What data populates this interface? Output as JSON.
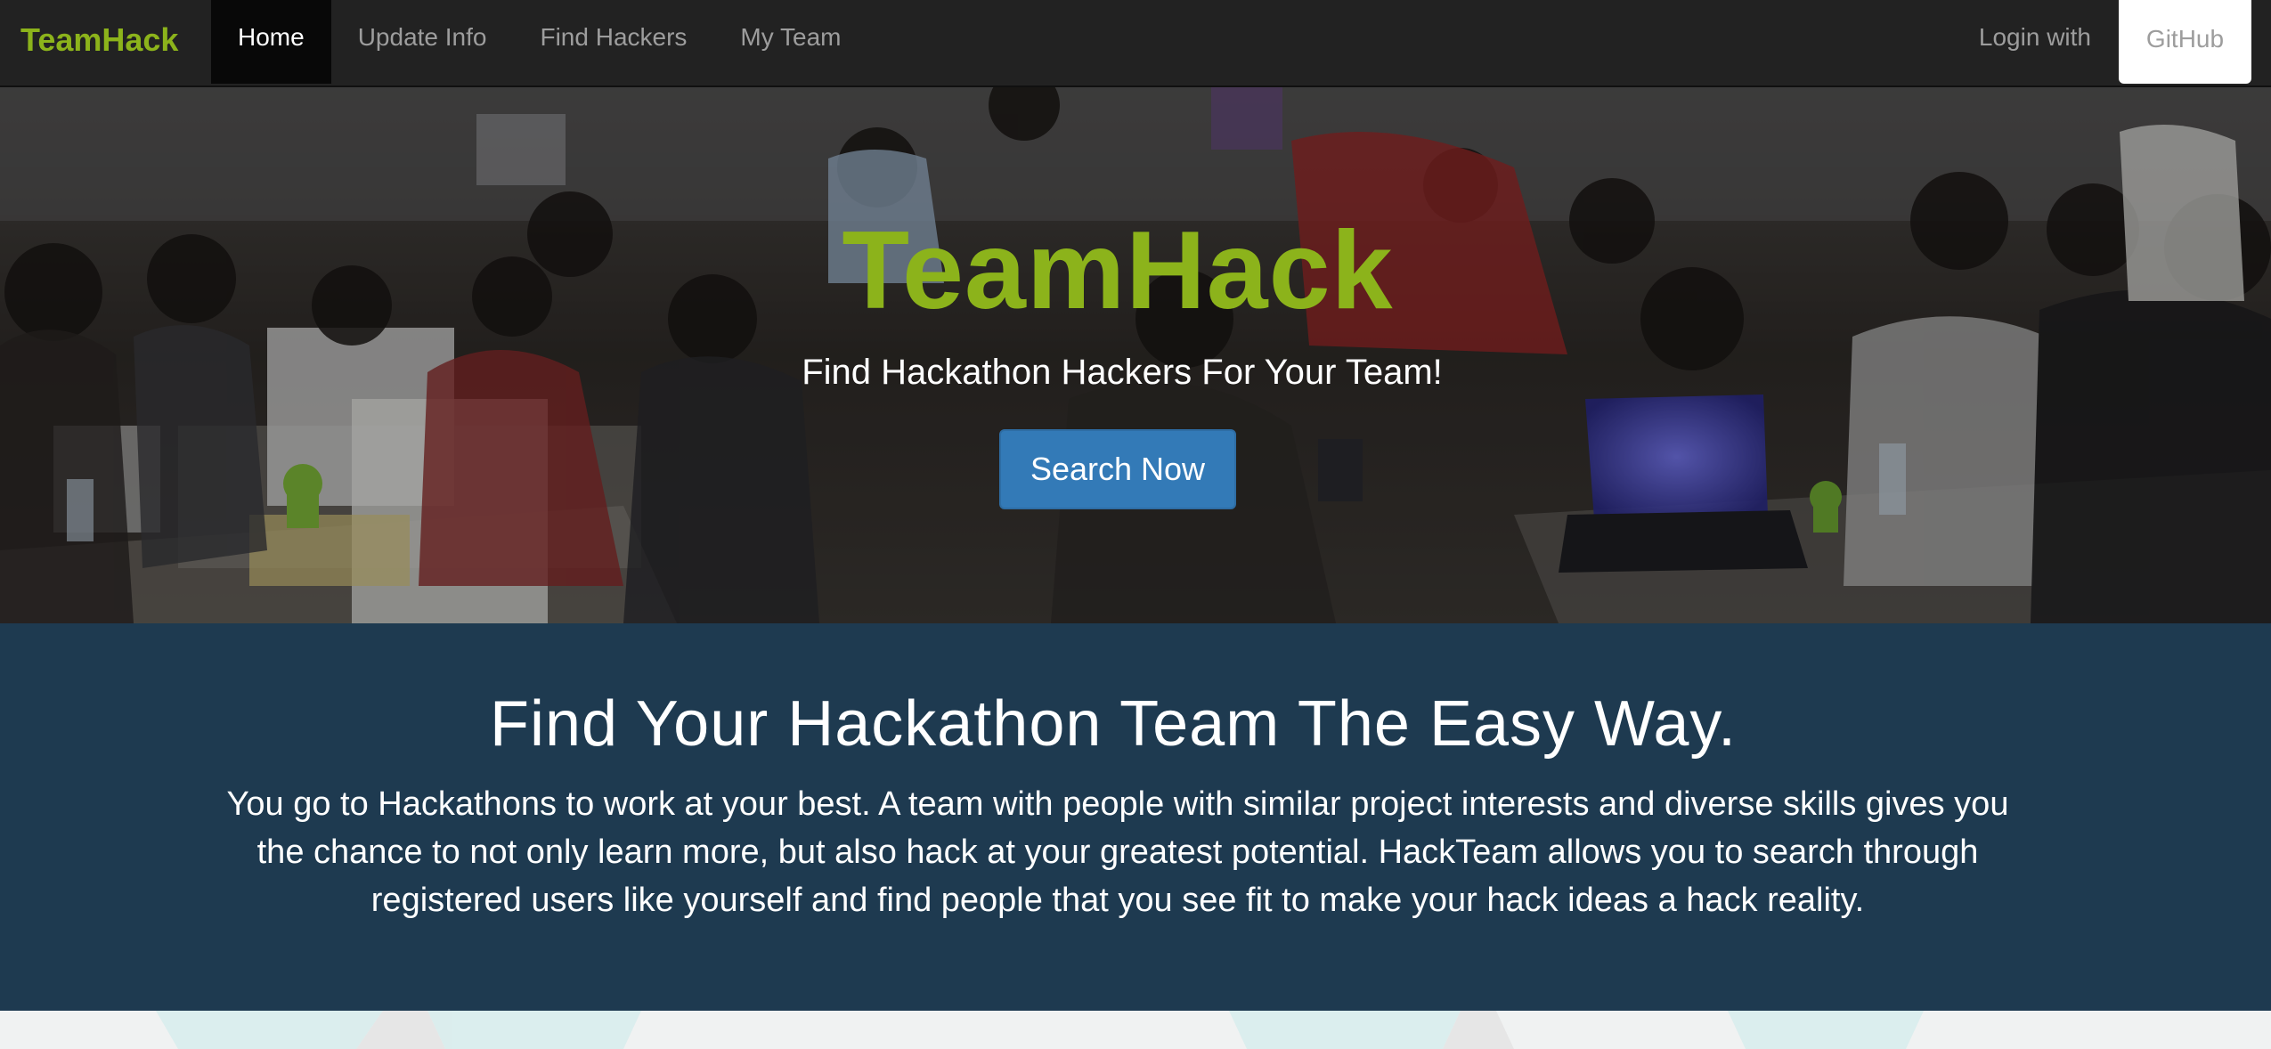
{
  "navbar": {
    "brand": "TeamHack",
    "links": [
      {
        "label": "Home",
        "active": true
      },
      {
        "label": "Update Info",
        "active": false
      },
      {
        "label": "Find Hackers",
        "active": false
      },
      {
        "label": "My Team",
        "active": false
      }
    ],
    "login_label": "Login with",
    "github_label": "GitHub"
  },
  "hero": {
    "title": "TeamHack",
    "subtitle": "Find Hackathon Hackers For Your Team!",
    "cta_label": "Search Now",
    "background_image": "hackathon-room-photo"
  },
  "info": {
    "heading": "Find Your Hackathon Team The Easy Way.",
    "body": "You go to Hackathons to work at your best. A team with people with similar project interests and diverse skills gives you the chance to not only learn more, but also hack at your greatest potential. HackTeam allows you to search through registered users like yourself and find people that you see fit to make your hack ideas a hack reality."
  },
  "colors": {
    "navbar_bg": "#222222",
    "brand_green": "#8cb31b",
    "primary_button": "#337ab7",
    "info_bg": "#1e3a50"
  }
}
